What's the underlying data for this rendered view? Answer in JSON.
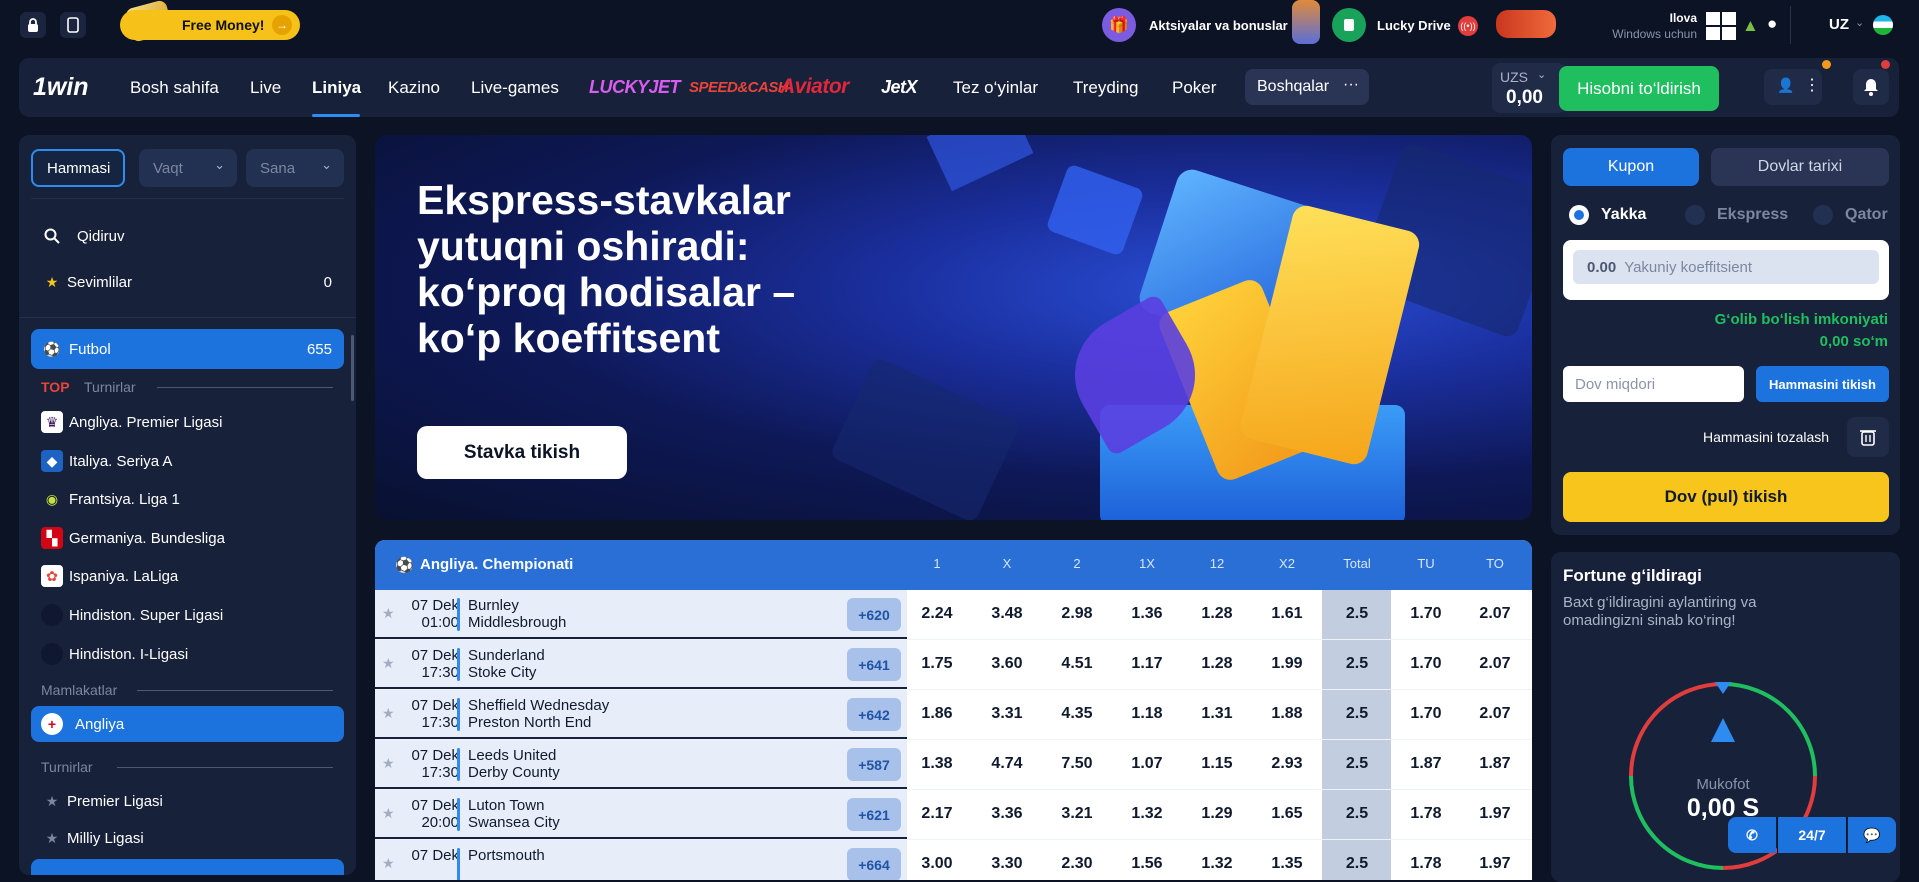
{
  "topbar": {
    "free_money": "Free Money!",
    "promo_label": "Aktsiyalar va bonuslar",
    "lucky_drive": "Lucky Drive",
    "app_line1": "Ilova",
    "app_line2": "Windows uchun",
    "lang": "UZ",
    "icons": [
      "lock-icon",
      "phone-icon",
      "gift-icon",
      "ticket-icon",
      "windows-icon",
      "android-icon",
      "apple-icon",
      "flag-icon"
    ]
  },
  "nav": {
    "logo": "1win",
    "items": [
      "Bosh sahifa",
      "Live",
      "Liniya",
      "Kazino",
      "Live-games"
    ],
    "games": [
      "LUCKYJET",
      "SPEED&CASH",
      "Aviator",
      "JetX"
    ],
    "items2": [
      "Tez o‘yinlar",
      "Treyding",
      "Poker"
    ],
    "more": "Boshqalar",
    "currency": "UZS",
    "balance": "0,00",
    "deposit": "Hisobni to‘ldirish",
    "active": "Liniya"
  },
  "sidebar": {
    "filters": {
      "all": "Hammasi",
      "time": "Vaqt",
      "date": "Sana"
    },
    "search": "Qidiruv",
    "favorites": "Sevimlilar",
    "favorites_count": "0",
    "sport": "Futbol",
    "sport_count": "655",
    "top_tag": "TOP",
    "tournaments_label": "Turnirlar",
    "top_tournaments": [
      "Angliya. Premier Ligasi",
      "Italiya. Seriya A",
      "Frantsiya. Liga 1",
      "Germaniya. Bundesliga",
      "Ispaniya. LaLiga",
      "Hindiston. Super Ligasi",
      "Hindiston. I-Ligasi"
    ],
    "countries_label": "Mamlakatlar",
    "country": "Angliya",
    "tournaments2_label": "Turnirlar",
    "tournaments2": [
      "Premier Ligasi",
      "Milliy Ligasi"
    ]
  },
  "banner": {
    "title": "Ekspress-stavkalar yutuqni oshiradi: ko‘proq hodisalar – ko‘p koeffitsent",
    "button": "Stavka tikish"
  },
  "table": {
    "league": "Angliya. Chempionati",
    "columns": [
      "1",
      "X",
      "2",
      "1X",
      "12",
      "X2",
      "Total",
      "TU",
      "TO"
    ],
    "rows": [
      {
        "date": "07 Dek",
        "time": "01:00",
        "home": "Burnley",
        "away": "Middlesbrough",
        "more": "+620",
        "odds": [
          "2.24",
          "3.48",
          "2.98",
          "1.36",
          "1.28",
          "1.61",
          "2.5",
          "1.70",
          "2.07"
        ]
      },
      {
        "date": "07 Dek",
        "time": "17:30",
        "home": "Sunderland",
        "away": "Stoke City",
        "more": "+641",
        "odds": [
          "1.75",
          "3.60",
          "4.51",
          "1.17",
          "1.28",
          "1.99",
          "2.5",
          "1.70",
          "2.07"
        ]
      },
      {
        "date": "07 Dek",
        "time": "17:30",
        "home": "Sheffield Wednesday",
        "away": "Preston North End",
        "more": "+642",
        "odds": [
          "1.86",
          "3.31",
          "4.35",
          "1.18",
          "1.31",
          "1.88",
          "2.5",
          "1.70",
          "2.07"
        ]
      },
      {
        "date": "07 Dek",
        "time": "17:30",
        "home": "Leeds United",
        "away": "Derby County",
        "more": "+587",
        "odds": [
          "1.38",
          "4.74",
          "7.50",
          "1.07",
          "1.15",
          "2.93",
          "2.5",
          "1.87",
          "1.87"
        ]
      },
      {
        "date": "07 Dek",
        "time": "20:00",
        "home": "Luton Town",
        "away": "Swansea City",
        "more": "+621",
        "odds": [
          "2.17",
          "3.36",
          "3.21",
          "1.32",
          "1.29",
          "1.65",
          "2.5",
          "1.78",
          "1.97"
        ]
      },
      {
        "date": "07 Dek",
        "time": "",
        "home": "Portsmouth",
        "away": "",
        "more": "+664",
        "odds": [
          "3.00",
          "3.30",
          "2.30",
          "1.56",
          "1.32",
          "1.35",
          "2.5",
          "1.78",
          "1.97"
        ]
      }
    ]
  },
  "betslip": {
    "tab_coupon": "Kupon",
    "tab_history": "Dovlar tarixi",
    "mode_single": "Yakka",
    "mode_express": "Ekspress",
    "mode_system": "Qator",
    "coef_value": "0.00",
    "coef_label": "Yakuniy koeffitsient",
    "win_label": "G‘olib bo‘lish imkoniyati",
    "win_value": "0,00 so‘m",
    "amount_placeholder": "Dov miqdori",
    "bet_all": "Hammasini tikish",
    "clear_all": "Hammasini tozalash",
    "place_bet": "Dov (pul) tikish"
  },
  "fortune": {
    "title": "Fortune g‘ildiragi",
    "subtitle": "Baxt g‘ildiragini aylantiring va omadingizni sinab ko‘ring!",
    "prize_label": "Mukofot",
    "prize_value": "0,00 S"
  },
  "support": {
    "hours": "24/7"
  },
  "colors": {
    "accent": "#1d73dd",
    "deposit": "#1fbf5f",
    "yellow": "#f7c51b",
    "bg": "#0b1324",
    "panel": "#17213a"
  }
}
